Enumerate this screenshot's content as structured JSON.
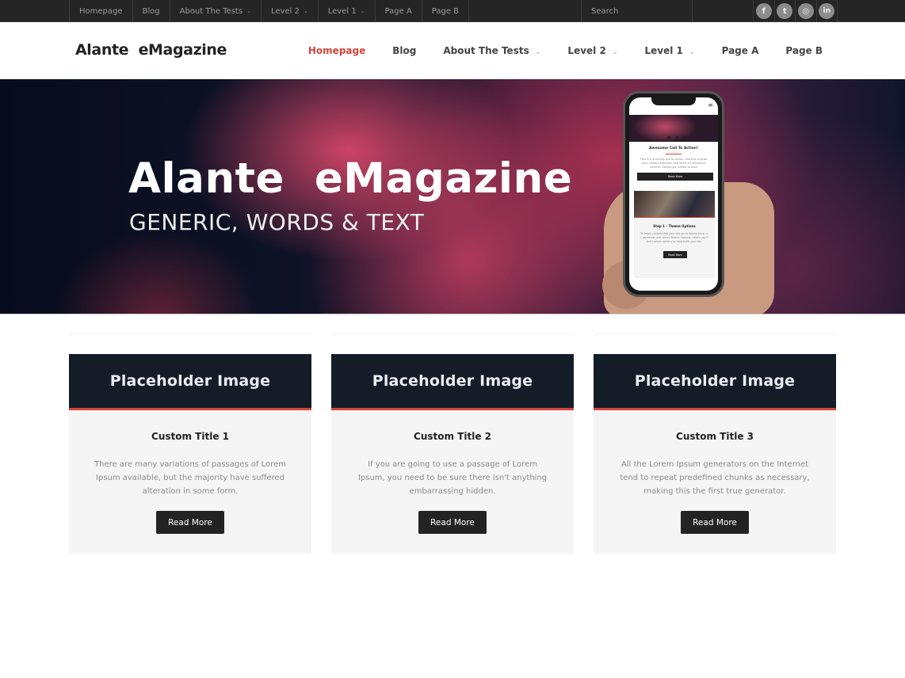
{
  "topbar": {
    "menu": [
      {
        "label": "Homepage",
        "has_dropdown": false
      },
      {
        "label": "Blog",
        "has_dropdown": false
      },
      {
        "label": "About The Tests",
        "has_dropdown": true
      },
      {
        "label": "Level 2",
        "has_dropdown": true
      },
      {
        "label": "Level 1",
        "has_dropdown": true
      },
      {
        "label": "Page A",
        "has_dropdown": false
      },
      {
        "label": "Page B",
        "has_dropdown": false
      }
    ],
    "search_placeholder": "Search",
    "social": [
      {
        "icon": "facebook-icon",
        "glyph": "f"
      },
      {
        "icon": "twitter-icon",
        "glyph": "t"
      },
      {
        "icon": "instagram-icon",
        "glyph": "◎"
      },
      {
        "icon": "linkedin-icon",
        "glyph": "in"
      }
    ],
    "chevron": "⌄"
  },
  "header": {
    "logo": "Alante  eMagazine",
    "nav": [
      {
        "label": "Homepage",
        "active": true,
        "has_dropdown": false
      },
      {
        "label": "Blog",
        "active": false,
        "has_dropdown": false
      },
      {
        "label": "About The Tests",
        "active": false,
        "has_dropdown": true
      },
      {
        "label": "Level 2",
        "active": false,
        "has_dropdown": true
      },
      {
        "label": "Level 1",
        "active": false,
        "has_dropdown": true
      },
      {
        "label": "Page A",
        "active": false,
        "has_dropdown": false
      },
      {
        "label": "Page B",
        "active": false,
        "has_dropdown": false
      }
    ],
    "accent_color": "#d6453a"
  },
  "hero": {
    "title": "Alante  eMagazine",
    "subtitle": "GENERIC, WORDS & TEXT",
    "phone": {
      "menu_glyph": "≡",
      "dots": "● ● ●",
      "cta_title": "Awesome Call To Action!",
      "cta_text": "This is a stunning call to action. Use this to grab your visitors attention and show off important content. Amazingly simple to add!",
      "cta_button": "Read More",
      "step_title": "Step 1 – Theme Options",
      "step_text": "To begin customizing your site go to Appearance -> Customizer and select Theme Options. Here's you'll find custom options to help build your site.",
      "step_button": "Read More"
    }
  },
  "cards": [
    {
      "image_label": "Placeholder Image",
      "title": "Custom Title 1",
      "text": "There are many variations of passages of Lorem Ipsum available, but the majority have suffered alteration in some form.",
      "button": "Read More"
    },
    {
      "image_label": "Placeholder Image",
      "title": "Custom Title 2",
      "text": "If you are going to use a passage of Lorem Ipsum, you need to be sure there isn't anything embarrassing hidden.",
      "button": "Read More"
    },
    {
      "image_label": "Placeholder Image",
      "title": "Custom Title 3",
      "text": "All the Lorem Ipsum generators on the Internet tend to repeat predefined chunks as necessary, making this the first true generator.",
      "button": "Read More"
    }
  ]
}
